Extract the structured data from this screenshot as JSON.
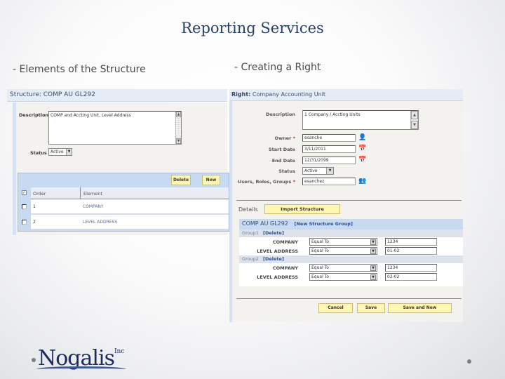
{
  "slide": {
    "title": "Reporting Services",
    "subtitle_left": "- Elements of the Structure",
    "subtitle_right": "- Creating a Right"
  },
  "structure_panel": {
    "header": "Structure: COMP AU GL292",
    "description_label": "Description",
    "description_value": "COMP and Accting Unit, Level Address",
    "status_label": "Status",
    "status_value": "Active",
    "delete_button": "Delete",
    "new_button": "New",
    "columns": [
      "Order",
      "Element"
    ],
    "rows": [
      {
        "order": "1",
        "element": "COMPANY"
      },
      {
        "order": "2",
        "element": "LEVEL ADDRESS"
      }
    ]
  },
  "right_panel": {
    "header_bold": "Right:",
    "header_name": "Company Accounting Unit",
    "description_label": "Description",
    "description_value": "1 Company / Accting Units",
    "owner_label": "Owner",
    "owner_value": "esanche",
    "start_date_label": "Start Date",
    "start_date_value": "3/11/2011",
    "end_date_label": "End Date",
    "end_date_value": "12/31/2099",
    "status_label": "Status",
    "status_value": "Active",
    "urg_label": "Users, Roles, Groups",
    "urg_value": "esanchez",
    "required_mark": "*",
    "details_label": "Details",
    "import_button": "Import Structure",
    "structure_name": "COMP AU GL292",
    "new_group_link": "[New Structure Group]",
    "groups": [
      {
        "name": "Group1",
        "delete_link": "[Delete]",
        "rows": [
          {
            "element": "COMPANY",
            "operator": "Equal To",
            "value": "1234"
          },
          {
            "element": "LEVEL ADDRESS",
            "operator": "Equal To",
            "value": "01-02"
          }
        ]
      },
      {
        "name": "Group2",
        "delete_link": "[Delete]",
        "rows": [
          {
            "element": "COMPANY",
            "operator": "Equal To",
            "value": "1234"
          },
          {
            "element": "LEVEL ADDRESS",
            "operator": "Equal To",
            "value": "02-02"
          }
        ]
      }
    ],
    "cancel_button": "Cancel",
    "save_button": "Save",
    "save_new_button": "Save and New"
  },
  "logo": {
    "name": "Nogalis",
    "suffix": "Inc"
  },
  "icons": {
    "scroll_up": "▲",
    "scroll_down": "▼",
    "dropdown": "▼",
    "user_lookup": "👤",
    "calendar": "📅",
    "group_lookup": "👥",
    "check": "✓"
  }
}
